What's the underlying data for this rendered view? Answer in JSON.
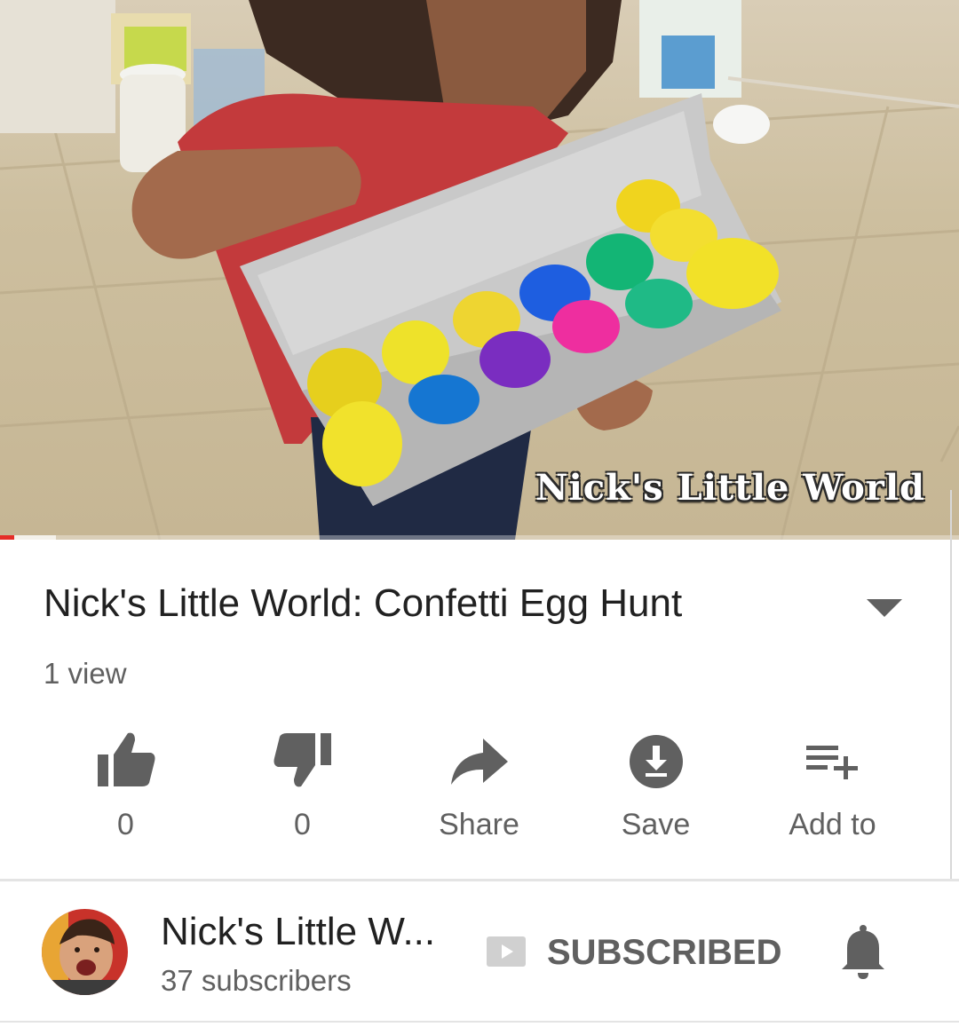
{
  "video": {
    "watermark": "Nick's Little World",
    "progress_fraction": 0.015,
    "buffered_fraction": 0.058
  },
  "info": {
    "title": "Nick's Little World: Confetti Egg Hunt",
    "views": "1 view"
  },
  "actions": [
    {
      "name": "like",
      "label": "0",
      "icon": "thumb-up-icon"
    },
    {
      "name": "dislike",
      "label": "0",
      "icon": "thumb-down-icon"
    },
    {
      "name": "share",
      "label": "Share",
      "icon": "share-arrow-icon"
    },
    {
      "name": "save",
      "label": "Save",
      "icon": "download-icon"
    },
    {
      "name": "add-to",
      "label": "Add to",
      "icon": "playlist-add-icon"
    }
  ],
  "channel": {
    "name": "Nick's Little W...",
    "subscribers": "37 subscribers",
    "subscribe_label": "SUBSCRIBED"
  },
  "colors": {
    "progress": "#e52d27",
    "icon_gray": "#606060"
  }
}
